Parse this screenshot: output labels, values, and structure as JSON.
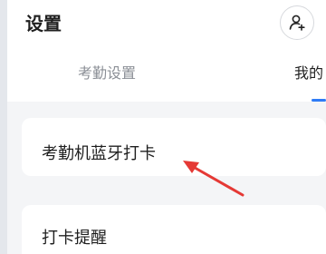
{
  "header": {
    "title": "设置"
  },
  "tabs": [
    {
      "label": "考勤设置"
    },
    {
      "label": "我的"
    }
  ],
  "settings": [
    {
      "label": "考勤机蓝牙打卡"
    },
    {
      "label": "打卡提醒"
    }
  ],
  "colors": {
    "accent": "#2f7cf6",
    "annotation_arrow": "#e53935",
    "background": "#f4f5f7"
  },
  "icons": {
    "add_person": "add-person-icon",
    "annotation": "red-arrow-icon"
  }
}
